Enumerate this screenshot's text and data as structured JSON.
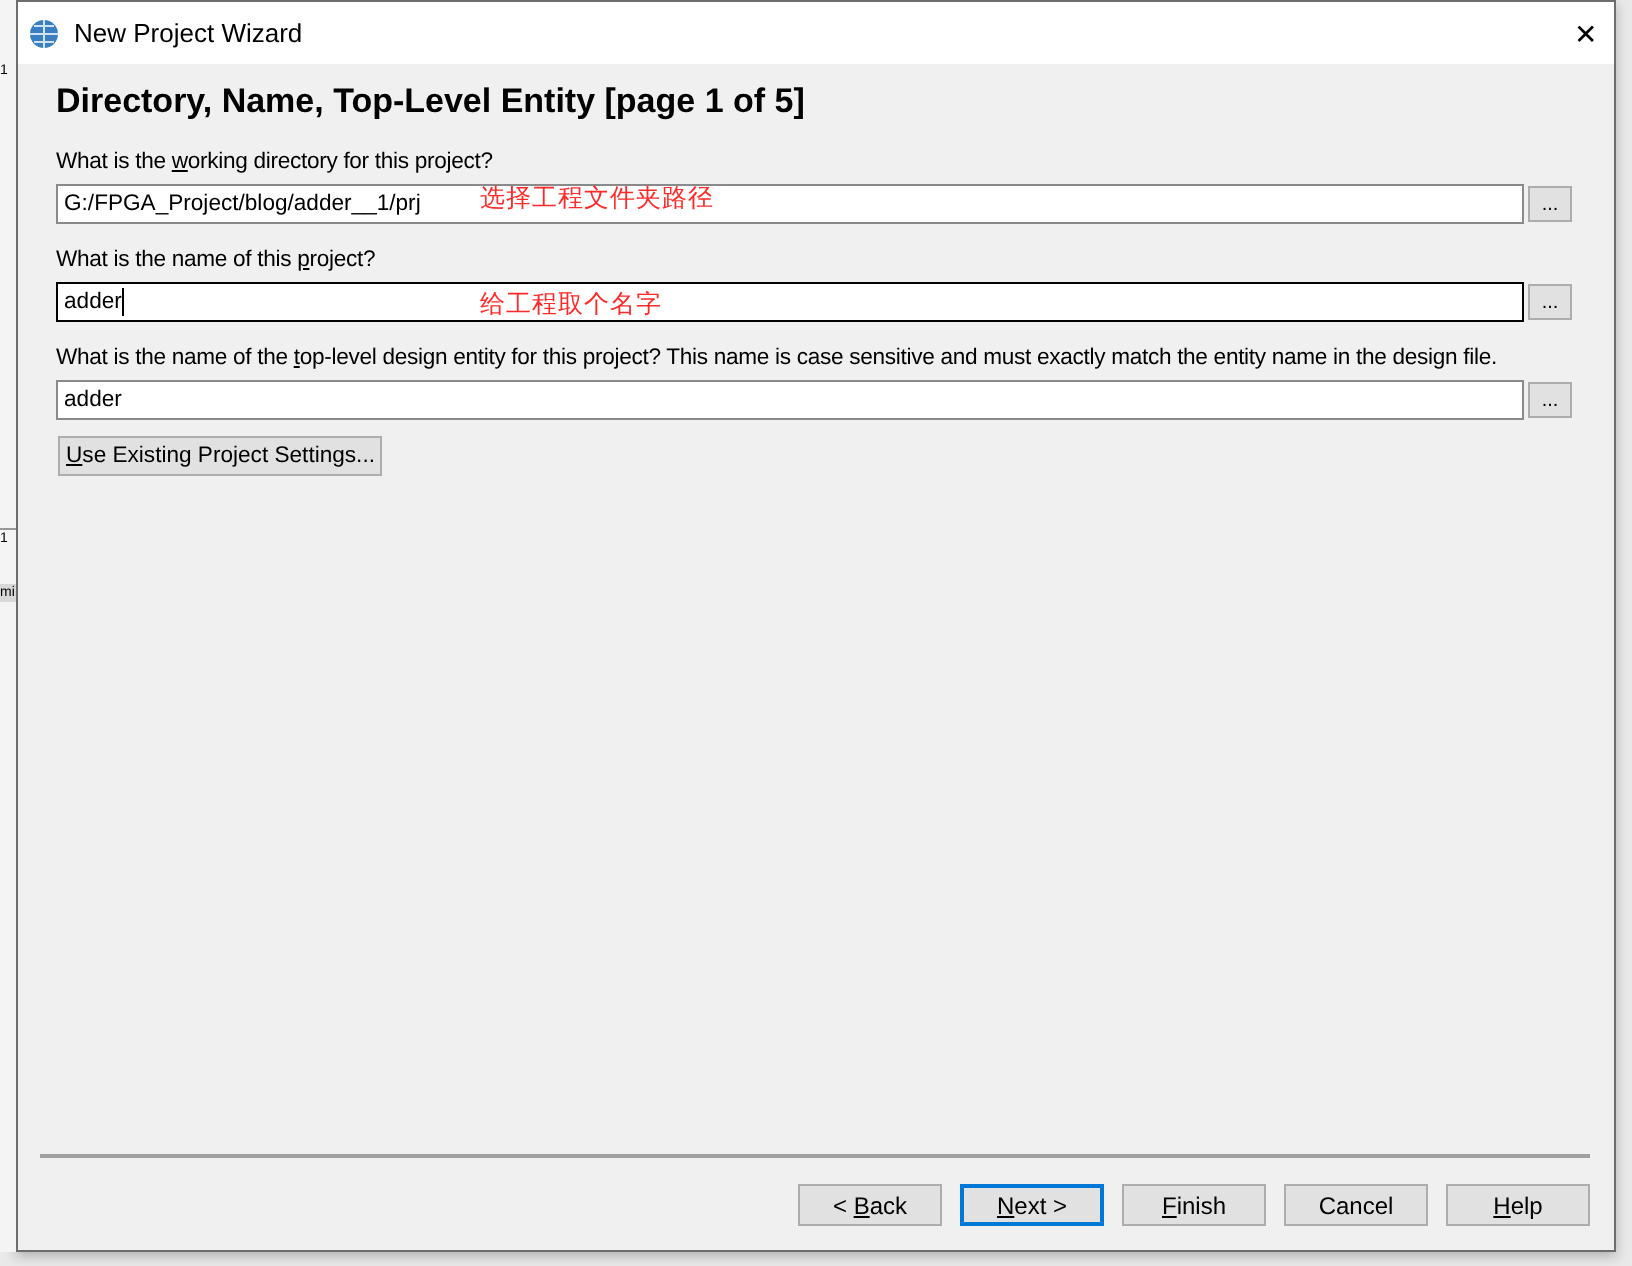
{
  "background_app": {
    "fragments": [
      {
        "text": "1"
      },
      {
        "text": "1"
      },
      {
        "text": "mi"
      }
    ]
  },
  "window": {
    "title": "New Project Wizard",
    "close": "✕"
  },
  "heading": "Directory, Name, Top-Level Entity [page 1 of 5]",
  "fields": [
    {
      "label": {
        "before": "What is the ",
        "key": "w",
        "after": "orking directory for this project?"
      },
      "value": "G:/FPGA_Project/blog/adder__1/prj",
      "focused": false,
      "browse": "...",
      "annotation": "选择工程文件夹路径"
    },
    {
      "label": {
        "before": "What is the name of this ",
        "key": "p",
        "after": "roject?"
      },
      "value": "adder",
      "focused": true,
      "browse": "...",
      "annotation": "给工程取个名字"
    },
    {
      "label": {
        "before": "What is the name of the ",
        "key": "t",
        "after": "op-level design entity for this project? This name is case sensitive and must exactly match the entity name in the design file."
      },
      "value": "adder",
      "focused": false,
      "browse": "..."
    }
  ],
  "settings_button": {
    "label": {
      "key": "U",
      "after": "se Existing Project Settings..."
    }
  },
  "buttons": [
    {
      "label": {
        "before": "< ",
        "key": "B",
        "after": "ack"
      },
      "default": false
    },
    {
      "label": {
        "key": "N",
        "after": "ext >"
      },
      "default": true
    },
    {
      "label": {
        "key": "F",
        "after": "inish"
      },
      "default": false
    },
    {
      "label": {
        "before": "Cancel"
      },
      "default": false
    },
    {
      "label": {
        "key": "H",
        "after": "elp"
      },
      "default": false
    }
  ]
}
